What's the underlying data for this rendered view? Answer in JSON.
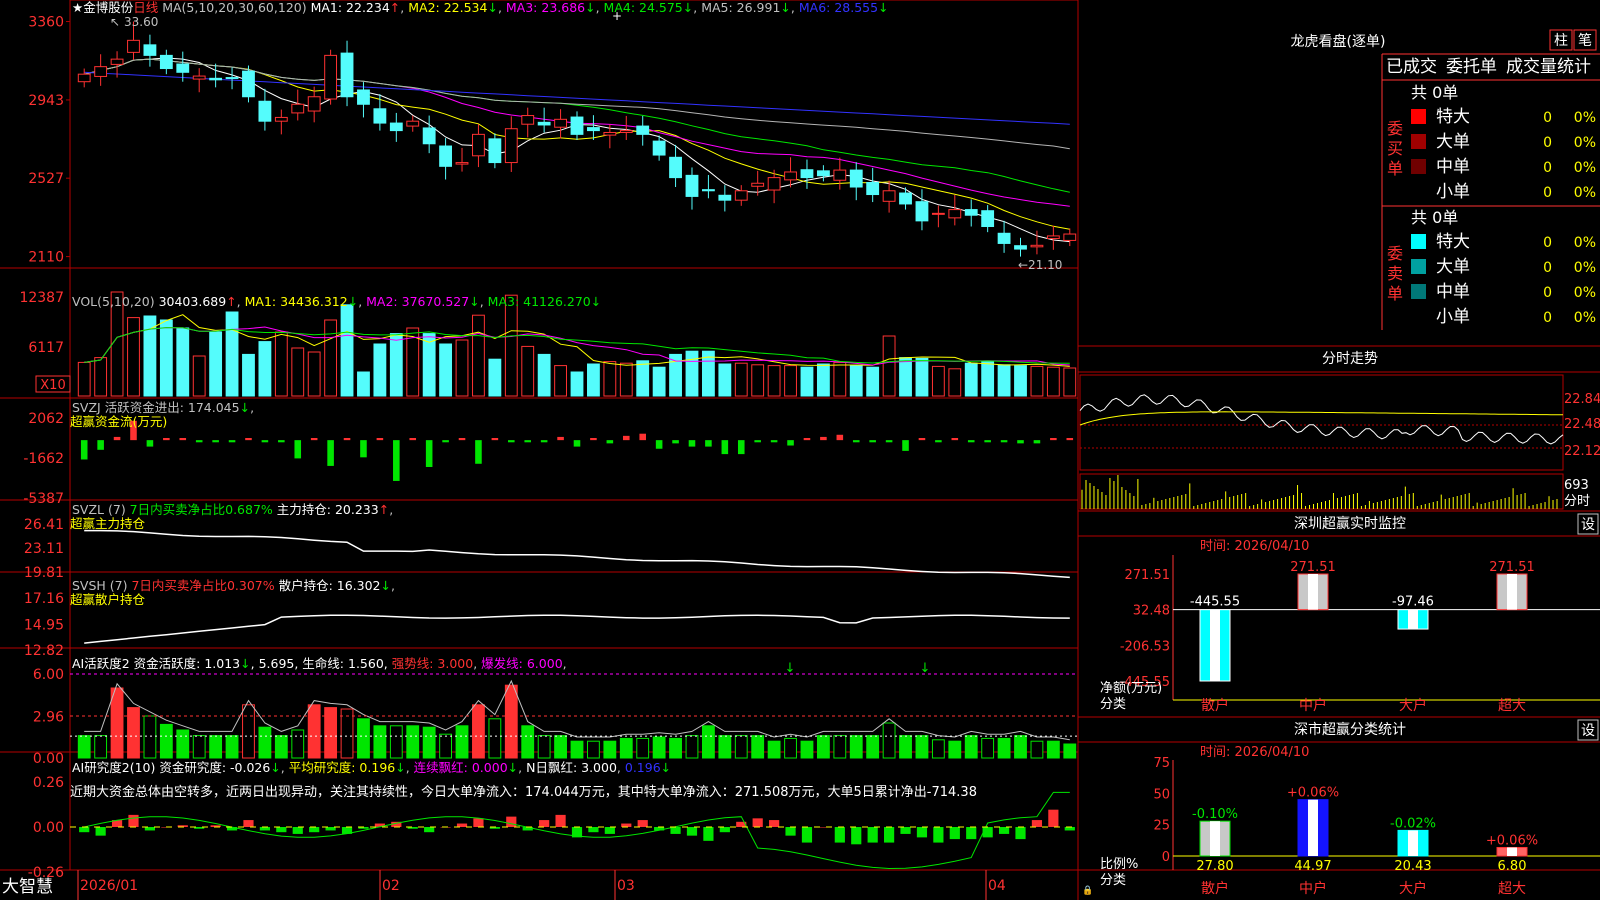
{
  "stock": {
    "name": "★金博股份",
    "period": "日线"
  },
  "colors": {
    "up": "#ff3232",
    "down": "#54fcfc",
    "grid": "#b40000",
    "ma1": "#ffffff",
    "ma2": "#ffff00",
    "ma3": "#ff00ff",
    "ma4": "#00e600",
    "ma5": "#b4b4b4",
    "ma6": "#3232ff"
  },
  "panels": {
    "kline": {
      "header": [
        {
          "text": "★金博股份",
          "color": "#ffffff"
        },
        {
          "text": "日线",
          "color": "#ff3232"
        },
        {
          "text": " MA(5,10,20,30,60,120) ",
          "color": "#c0c0c0"
        },
        {
          "text": "MA1: 22.234",
          "color": "#ffffff"
        },
        {
          "text": "↑",
          "color": "#ff3232"
        },
        {
          "text": ", ",
          "color": "#c0c0c0"
        },
        {
          "text": "MA2: 22.534",
          "color": "#ffff00"
        },
        {
          "text": "↓",
          "color": "#00e600"
        },
        {
          "text": ", ",
          "color": "#c0c0c0"
        },
        {
          "text": "MA3: 23.686",
          "color": "#ff00ff"
        },
        {
          "text": "↓",
          "color": "#00e600"
        },
        {
          "text": ", ",
          "color": "#c0c0c0"
        },
        {
          "text": "MA4: 24.575",
          "color": "#00e600"
        },
        {
          "text": "↓",
          "color": "#00e600"
        },
        {
          "text": ", ",
          "color": "#c0c0c0"
        },
        {
          "text": "MA5: 26.991",
          "color": "#c0c0c0"
        },
        {
          "text": "↓",
          "color": "#00e600"
        },
        {
          "text": ", ",
          "color": "#c0c0c0"
        },
        {
          "text": "MA6: 28.555",
          "color": "#3232ff"
        },
        {
          "text": "↓",
          "color": "#00e600"
        }
      ],
      "yticks": [
        "3360",
        "2943",
        "2527",
        "2110"
      ],
      "high_label": "33.60",
      "low_label": "←21.10",
      "high_arrow": "↖"
    },
    "vol": {
      "header": [
        {
          "text": "VOL(5,10,20) ",
          "color": "#c0c0c0"
        },
        {
          "text": "30403.689",
          "color": "#ffffff"
        },
        {
          "text": "↑",
          "color": "#ff3232"
        },
        {
          "text": ", ",
          "color": "#c0c0c0"
        },
        {
          "text": "MA1: 34436.312",
          "color": "#ffff00"
        },
        {
          "text": "↓",
          "color": "#00e600"
        },
        {
          "text": ", ",
          "color": "#c0c0c0"
        },
        {
          "text": "MA2: 37670.527",
          "color": "#ff00ff"
        },
        {
          "text": "↓",
          "color": "#00e600"
        },
        {
          "text": ", ",
          "color": "#c0c0c0"
        },
        {
          "text": "MA3: 41126.270",
          "color": "#00e600"
        },
        {
          "text": "↓",
          "color": "#00e600"
        }
      ],
      "yticks": [
        "12387",
        "6117"
      ],
      "unit": "X10"
    },
    "svzj": {
      "header": [
        {
          "text": "SVZJ  活跃资金进出: 174.045",
          "color": "#c0c0c0"
        },
        {
          "text": "↓",
          "color": "#00e600"
        },
        {
          "text": ",",
          "color": "#c0c0c0"
        }
      ],
      "sub": "超赢资金流(万元)",
      "yticks": [
        "2062",
        "-1662",
        "-5387"
      ]
    },
    "svzl": {
      "header": [
        {
          "text": "SVZL (7) ",
          "color": "#c0c0c0"
        },
        {
          "text": "7日内买卖净占比0.687%",
          "color": "#00e600"
        },
        {
          "text": " 主力持仓: 20.233",
          "color": "#ffffff"
        },
        {
          "text": "↑",
          "color": "#ff3232"
        },
        {
          "text": ",",
          "color": "#c0c0c0"
        }
      ],
      "sub": "超赢主力持仓",
      "yticks": [
        "26.41",
        "23.11",
        "19.81"
      ]
    },
    "svsh": {
      "header": [
        {
          "text": "SVSH (7) ",
          "color": "#c0c0c0"
        },
        {
          "text": "7日内买卖净占比0.307%",
          "color": "#ff3232"
        },
        {
          "text": " 散户持仓: 16.302",
          "color": "#ffffff"
        },
        {
          "text": "↓",
          "color": "#00e600"
        },
        {
          "text": ",",
          "color": "#c0c0c0"
        }
      ],
      "sub": "超赢散户持仓",
      "yticks": [
        "17.16",
        "14.95",
        "12.82"
      ]
    },
    "ai1": {
      "header": [
        {
          "text": "AI活跃度2 资金活跃度: 1.013",
          "color": "#ffffff"
        },
        {
          "text": "↓",
          "color": "#00e600"
        },
        {
          "text": ", 5.695, 生命线: 1.560, ",
          "color": "#ffffff"
        },
        {
          "text": "强势线: 3.000",
          "color": "#ff3232"
        },
        {
          "text": ", ",
          "color": "#c0c0c0"
        },
        {
          "text": "爆发线: 6.000",
          "color": "#ff00ff"
        },
        {
          "text": ",",
          "color": "#c0c0c0"
        }
      ],
      "yticks": [
        "6.00",
        "2.96",
        "0.00"
      ]
    },
    "ai2": {
      "header": [
        {
          "text": "AI研究度2(10) 资金研究度: -0.026",
          "color": "#ffffff"
        },
        {
          "text": "↓",
          "color": "#00e600"
        },
        {
          "text": ", ",
          "color": "#c0c0c0"
        },
        {
          "text": "平均研究度: 0.196",
          "color": "#ffff00"
        },
        {
          "text": "↓",
          "color": "#00e600"
        },
        {
          "text": ", ",
          "color": "#c0c0c0"
        },
        {
          "text": "连续飘红: 0.000",
          "color": "#ff00ff"
        },
        {
          "text": "↓",
          "color": "#00e600"
        },
        {
          "text": ", ",
          "color": "#c0c0c0"
        },
        {
          "text": "N日飘红: 3.000",
          "color": "#ffffff"
        },
        {
          "text": ", ",
          "color": "#c0c0c0"
        },
        {
          "text": "0.196",
          "color": "#3232ff"
        },
        {
          "text": "↓",
          "color": "#00e600"
        }
      ],
      "comment": "近期大资金总体由空转多，近两日出现异动，关注其持续性，今日大单净流入：174.044万元，其中特大单净流入：271.508万元，大单5日累计净出-714.38",
      "yticks": [
        "0.26",
        "0.00",
        "-0.26"
      ]
    }
  },
  "xaxis": {
    "labels": [
      "2026/01",
      "02",
      "03",
      "04"
    ]
  },
  "brand": "大智慧",
  "right": {
    "dragon": {
      "title": "龙虎看盘(逐单)",
      "btn_zhu": "柱",
      "btn_bi": "笔",
      "tabs": [
        "已成交",
        "委托单",
        "成交量统计"
      ],
      "buy": {
        "side_label": "委买单",
        "total": "共 0单",
        "rows": [
          {
            "label": "特大",
            "count": "0",
            "pct": "0%",
            "color": "#ff0000"
          },
          {
            "label": "大单",
            "count": "0",
            "pct": "0%",
            "color": "#a00000"
          },
          {
            "label": "中单",
            "count": "0",
            "pct": "0%",
            "color": "#700000"
          },
          {
            "label": "小单",
            "count": "0",
            "pct": "0%",
            "color": "#000000"
          }
        ]
      },
      "sell": {
        "side_label": "委卖单",
        "total": "共 0单",
        "rows": [
          {
            "label": "特大",
            "count": "0",
            "pct": "0%",
            "color": "#00ffff"
          },
          {
            "label": "大单",
            "count": "0",
            "pct": "0%",
            "color": "#00a0a0"
          },
          {
            "label": "中单",
            "count": "0",
            "pct": "0%",
            "color": "#007878"
          },
          {
            "label": "小单",
            "count": "0",
            "pct": "0%",
            "color": "#000000"
          }
        ]
      }
    },
    "intraday": {
      "title": "分时走势",
      "yticks": [
        "22.84",
        "22.48",
        "22.12"
      ],
      "vol_tick": "693",
      "vol_label": "分时"
    },
    "szmon": {
      "title": "深圳超赢实时监控",
      "settings": "设",
      "time": "时间: 2026/04/10",
      "yticks": [
        "271.51",
        "32.48",
        "-206.53",
        "-445.55"
      ],
      "ylabel": "净额(万元)",
      "xlabel": "分类",
      "categories": [
        "散户",
        "中户",
        "大户",
        "超大"
      ],
      "values": [
        -445.55,
        271.51,
        -97.46,
        271.51
      ],
      "value_labels": [
        "-445.55",
        "271.51",
        "-97.46",
        "271.51"
      ]
    },
    "szstat": {
      "title": "深市超赢分类统计",
      "settings": "设",
      "time": "时间: 2026/04/10",
      "yticks": [
        "75",
        "50",
        "25",
        "0"
      ],
      "ylabel": "比例%",
      "xlabel": "分类",
      "categories": [
        "散户",
        "中户",
        "大户",
        "超大"
      ],
      "values": [
        27.8,
        44.97,
        20.43,
        6.8
      ],
      "value_labels": [
        "27.80",
        "44.97",
        "20.43",
        "6.80"
      ],
      "changes": [
        "-0.10%",
        "+0.06%",
        "-0.02%",
        "+0.06%"
      ],
      "change_colors": [
        "#00e600",
        "#ff3232",
        "#00e600",
        "#ff3232"
      ]
    }
  }
}
